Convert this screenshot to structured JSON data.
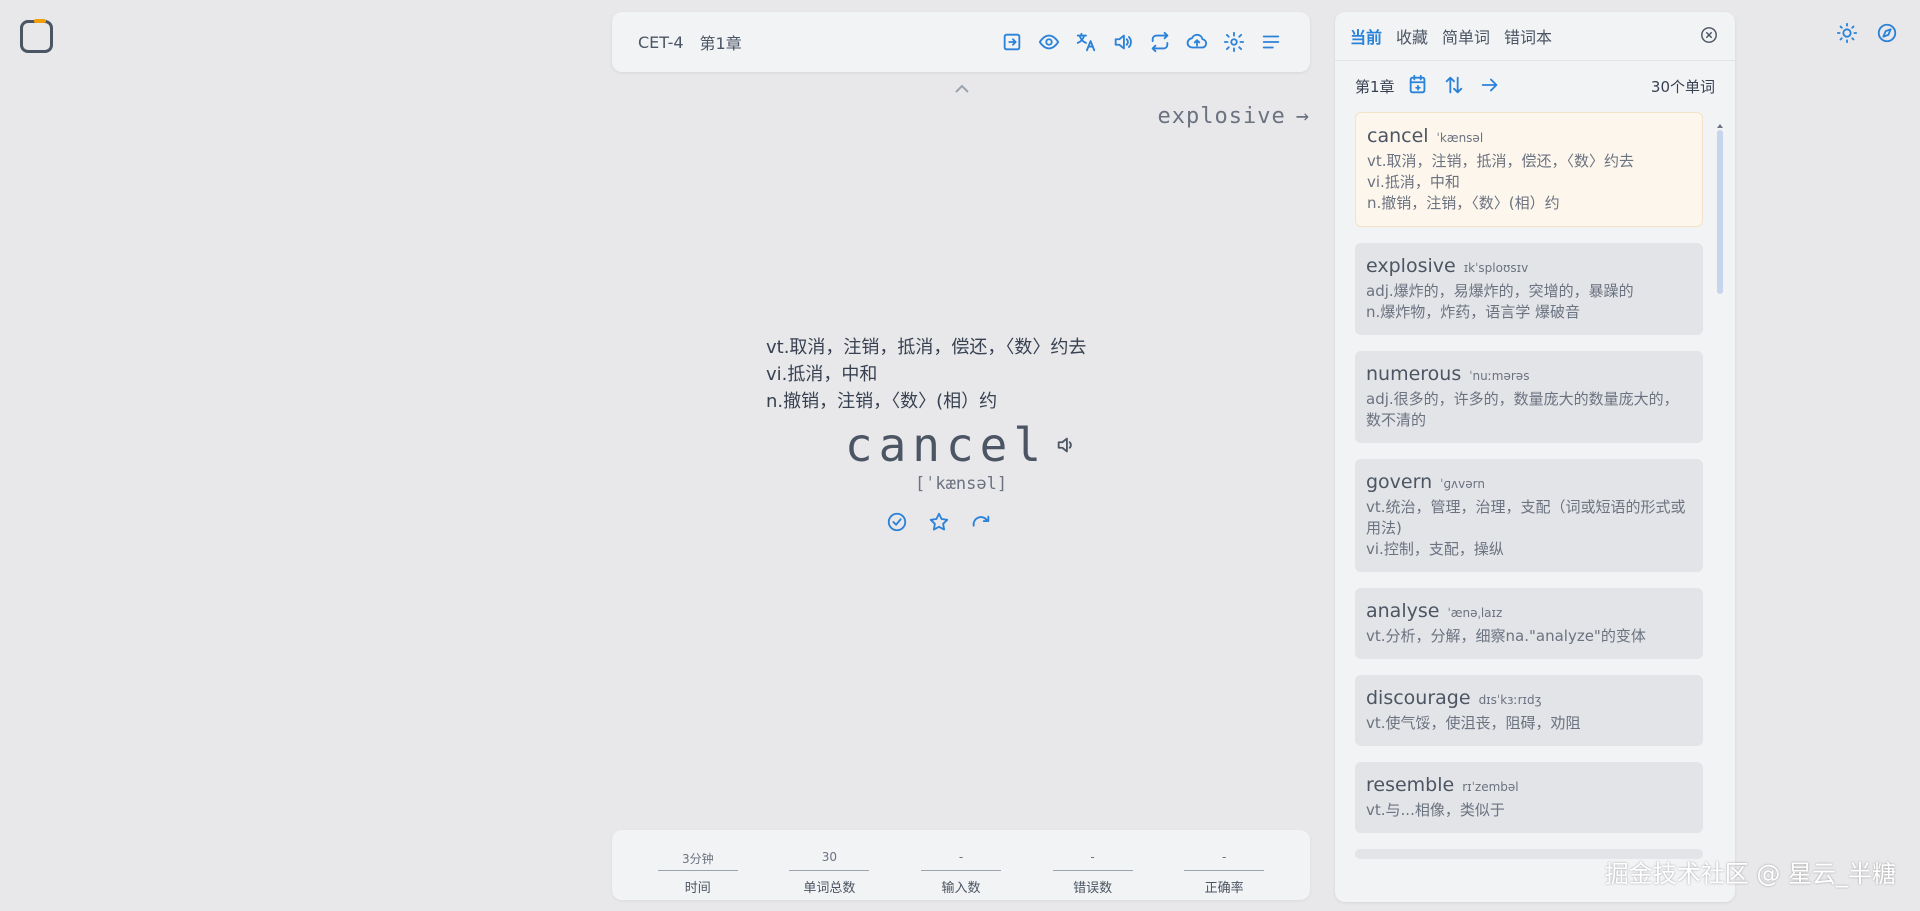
{
  "topbar": {
    "dict": "CET-4",
    "chapter": "第1章"
  },
  "next": {
    "word": "explosive"
  },
  "current": {
    "trans": [
      "vt.取消，注销，抵消，偿还，〈数〉约去",
      "vi.抵消，中和",
      "n.撤销，注销，〈数〉(相）约"
    ],
    "word": "cancel",
    "phonetic": "[ˈkænsəl]"
  },
  "stats": [
    {
      "value": "3分钟",
      "label": "时间"
    },
    {
      "value": "30",
      "label": "单词总数"
    },
    {
      "value": "-",
      "label": "输入数"
    },
    {
      "value": "-",
      "label": "错误数"
    },
    {
      "value": "-",
      "label": "正确率"
    }
  ],
  "panel": {
    "tabs": [
      "当前",
      "收藏",
      "简单词",
      "错词本"
    ],
    "chapter": "第1章",
    "count": "30个单词",
    "words": [
      {
        "w": "cancel",
        "p": "ˈkænsəl",
        "d": [
          "vt.取消，注销，抵消，偿还，〈数〉约去",
          "vi.抵消，中和",
          "n.撤销，注销，〈数〉(相）约"
        ]
      },
      {
        "w": "explosive",
        "p": "ɪkˈsploʊsɪv",
        "d": [
          "adj.爆炸的，易爆炸的，突增的，暴躁的",
          "n.爆炸物，炸药，语言学 爆破音"
        ]
      },
      {
        "w": "numerous",
        "p": "ˈnuːmərəs",
        "d": [
          "adj.很多的，许多的，数量庞大的数量庞大的，数不清的"
        ]
      },
      {
        "w": "govern",
        "p": "ˈɡʌvərn",
        "d": [
          "vt.统治，管理，治理，支配（词或短语的形式或用法)",
          "vi.控制，支配，操纵"
        ]
      },
      {
        "w": "analyse",
        "p": "ˈænəˌlaɪz",
        "d": [
          "vt.分析，分解，细察na.\"analyze\"的变体"
        ]
      },
      {
        "w": "discourage",
        "p": "dɪsˈkɜːrɪdʒ",
        "d": [
          "vt.使气馁，使沮丧，阻碍，劝阻"
        ]
      },
      {
        "w": "resemble",
        "p": "rɪˈzembəl",
        "d": [
          "vt.与...相像，类似于"
        ]
      }
    ]
  },
  "watermark": "掘金技术社区 @ 星云_半糖"
}
